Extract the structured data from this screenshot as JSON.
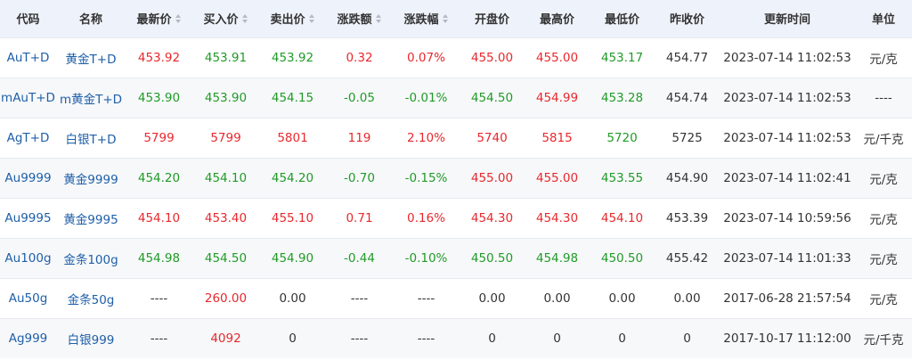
{
  "columns": [
    {
      "label": "代码",
      "sortable": false
    },
    {
      "label": "名称",
      "sortable": false
    },
    {
      "label": "最新价",
      "sortable": true
    },
    {
      "label": "买入价",
      "sortable": true
    },
    {
      "label": "卖出价",
      "sortable": true
    },
    {
      "label": "涨跌额",
      "sortable": true
    },
    {
      "label": "涨跌幅",
      "sortable": true
    },
    {
      "label": "开盘价",
      "sortable": false
    },
    {
      "label": "最高价",
      "sortable": false
    },
    {
      "label": "最低价",
      "sortable": false
    },
    {
      "label": "昨收价",
      "sortable": false
    },
    {
      "label": "更新时间",
      "sortable": false
    },
    {
      "label": "单位",
      "sortable": false
    }
  ],
  "colors": {
    "up": "#e8282d",
    "down": "#209b27",
    "flat": "#333333",
    "link": "#1f5fa8",
    "header_bg": "#eef3fb"
  },
  "rows": [
    {
      "cells": [
        {
          "v": "AuT+D",
          "c": "code"
        },
        {
          "v": "黄金T+D",
          "c": "name"
        },
        {
          "v": "453.92",
          "c": "up"
        },
        {
          "v": "453.91",
          "c": "down"
        },
        {
          "v": "453.92",
          "c": "down"
        },
        {
          "v": "0.32",
          "c": "up"
        },
        {
          "v": "0.07%",
          "c": "up"
        },
        {
          "v": "455.00",
          "c": "up"
        },
        {
          "v": "455.00",
          "c": "up"
        },
        {
          "v": "453.17",
          "c": "down"
        },
        {
          "v": "454.77",
          "c": "flat"
        },
        {
          "v": "2023-07-14 11:02:53",
          "c": "flat"
        },
        {
          "v": "元/克",
          "c": "flat"
        }
      ]
    },
    {
      "cells": [
        {
          "v": "mAuT+D",
          "c": "code"
        },
        {
          "v": "m黄金T+D",
          "c": "name"
        },
        {
          "v": "453.90",
          "c": "down"
        },
        {
          "v": "453.90",
          "c": "down"
        },
        {
          "v": "454.15",
          "c": "down"
        },
        {
          "v": "-0.05",
          "c": "down"
        },
        {
          "v": "-0.01%",
          "c": "down"
        },
        {
          "v": "454.50",
          "c": "down"
        },
        {
          "v": "454.99",
          "c": "up"
        },
        {
          "v": "453.28",
          "c": "down"
        },
        {
          "v": "454.74",
          "c": "flat"
        },
        {
          "v": "2023-07-14 11:02:53",
          "c": "flat"
        },
        {
          "v": "----",
          "c": "flat"
        }
      ]
    },
    {
      "cells": [
        {
          "v": "AgT+D",
          "c": "code"
        },
        {
          "v": "白银T+D",
          "c": "name"
        },
        {
          "v": "5799",
          "c": "up"
        },
        {
          "v": "5799",
          "c": "up"
        },
        {
          "v": "5801",
          "c": "up"
        },
        {
          "v": "119",
          "c": "up"
        },
        {
          "v": "2.10%",
          "c": "up"
        },
        {
          "v": "5740",
          "c": "up"
        },
        {
          "v": "5815",
          "c": "up"
        },
        {
          "v": "5720",
          "c": "down"
        },
        {
          "v": "5725",
          "c": "flat"
        },
        {
          "v": "2023-07-14 11:02:53",
          "c": "flat"
        },
        {
          "v": "元/千克",
          "c": "flat"
        }
      ]
    },
    {
      "cells": [
        {
          "v": "Au9999",
          "c": "code"
        },
        {
          "v": "黄金9999",
          "c": "name"
        },
        {
          "v": "454.20",
          "c": "down"
        },
        {
          "v": "454.10",
          "c": "down"
        },
        {
          "v": "454.20",
          "c": "down"
        },
        {
          "v": "-0.70",
          "c": "down"
        },
        {
          "v": "-0.15%",
          "c": "down"
        },
        {
          "v": "455.00",
          "c": "up"
        },
        {
          "v": "455.00",
          "c": "up"
        },
        {
          "v": "453.55",
          "c": "down"
        },
        {
          "v": "454.90",
          "c": "flat"
        },
        {
          "v": "2023-07-14 11:02:41",
          "c": "flat"
        },
        {
          "v": "元/克",
          "c": "flat"
        }
      ]
    },
    {
      "cells": [
        {
          "v": "Au9995",
          "c": "code"
        },
        {
          "v": "黄金9995",
          "c": "name"
        },
        {
          "v": "454.10",
          "c": "up"
        },
        {
          "v": "453.40",
          "c": "up"
        },
        {
          "v": "455.10",
          "c": "up"
        },
        {
          "v": "0.71",
          "c": "up"
        },
        {
          "v": "0.16%",
          "c": "up"
        },
        {
          "v": "454.30",
          "c": "up"
        },
        {
          "v": "454.30",
          "c": "up"
        },
        {
          "v": "454.10",
          "c": "up"
        },
        {
          "v": "453.39",
          "c": "flat"
        },
        {
          "v": "2023-07-14 10:59:56",
          "c": "flat"
        },
        {
          "v": "元/克",
          "c": "flat"
        }
      ]
    },
    {
      "cells": [
        {
          "v": "Au100g",
          "c": "code"
        },
        {
          "v": "金条100g",
          "c": "name"
        },
        {
          "v": "454.98",
          "c": "down"
        },
        {
          "v": "454.50",
          "c": "down"
        },
        {
          "v": "454.90",
          "c": "down"
        },
        {
          "v": "-0.44",
          "c": "down"
        },
        {
          "v": "-0.10%",
          "c": "down"
        },
        {
          "v": "450.50",
          "c": "down"
        },
        {
          "v": "454.98",
          "c": "down"
        },
        {
          "v": "450.50",
          "c": "down"
        },
        {
          "v": "455.42",
          "c": "flat"
        },
        {
          "v": "2023-07-14 11:01:33",
          "c": "flat"
        },
        {
          "v": "元/克",
          "c": "flat"
        }
      ]
    },
    {
      "cells": [
        {
          "v": "Au50g",
          "c": "code"
        },
        {
          "v": "金条50g",
          "c": "name"
        },
        {
          "v": "----",
          "c": "flat"
        },
        {
          "v": "260.00",
          "c": "up"
        },
        {
          "v": "0.00",
          "c": "flat"
        },
        {
          "v": "----",
          "c": "flat"
        },
        {
          "v": "----",
          "c": "flat"
        },
        {
          "v": "0.00",
          "c": "flat"
        },
        {
          "v": "0.00",
          "c": "flat"
        },
        {
          "v": "0.00",
          "c": "flat"
        },
        {
          "v": "0.00",
          "c": "flat"
        },
        {
          "v": "2017-06-28 21:57:54",
          "c": "flat"
        },
        {
          "v": "元/克",
          "c": "flat"
        }
      ]
    },
    {
      "cells": [
        {
          "v": "Ag999",
          "c": "code"
        },
        {
          "v": "白银999",
          "c": "name"
        },
        {
          "v": "----",
          "c": "flat"
        },
        {
          "v": "4092",
          "c": "up"
        },
        {
          "v": "0",
          "c": "flat"
        },
        {
          "v": "----",
          "c": "flat"
        },
        {
          "v": "----",
          "c": "flat"
        },
        {
          "v": "0",
          "c": "flat"
        },
        {
          "v": "0",
          "c": "flat"
        },
        {
          "v": "0",
          "c": "flat"
        },
        {
          "v": "0",
          "c": "flat"
        },
        {
          "v": "2017-10-17 11:12:00",
          "c": "flat"
        },
        {
          "v": "元/千克",
          "c": "flat"
        }
      ]
    }
  ]
}
